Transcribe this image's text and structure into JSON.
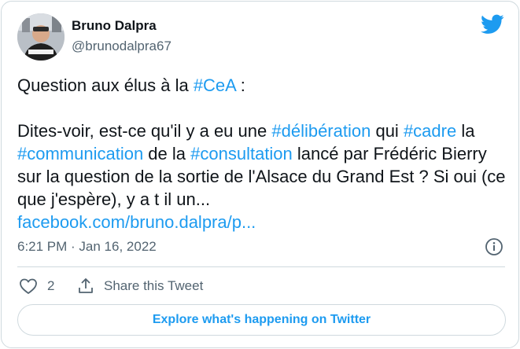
{
  "author": {
    "name": "Bruno Dalpra",
    "handle": "@brunodalpra67",
    "avatar_icon": "profile-photo"
  },
  "brand": {
    "icon": "twitter-bird-icon",
    "color": "#1d9bf0"
  },
  "tweet": {
    "line1_text": "Question aux élus à la ",
    "line1_tag": "#CeA",
    "line1_end": " :",
    "p2_a": "Dites-voir, est-ce qu'il y a eu une ",
    "p2_tag_deliberation": "#délibération",
    "p2_b": " qui ",
    "p2_tag_cadre": "#cadre",
    "p2_c": " la ",
    "p2_tag_communication": "#communication",
    "p2_d": " de la ",
    "p2_tag_consultation": "#consultation",
    "p2_e": " lancé par Frédéric Bierry sur la question de la sortie de l'Alsace du Grand Est ? Si oui (ce que j'espère), y a t il un...",
    "link": "facebook.com/bruno.dalpra/p..."
  },
  "meta": {
    "timestamp": "6:21 PM · Jan 16, 2022",
    "info_icon": "info-icon"
  },
  "actions": {
    "like_count": "2",
    "share_label": "Share this Tweet"
  },
  "explore_label": "Explore what's happening on Twitter",
  "colors": {
    "link": "#1d9bf0",
    "text": "#0f1419",
    "secondary": "#536471",
    "border": "#cfd9de"
  }
}
